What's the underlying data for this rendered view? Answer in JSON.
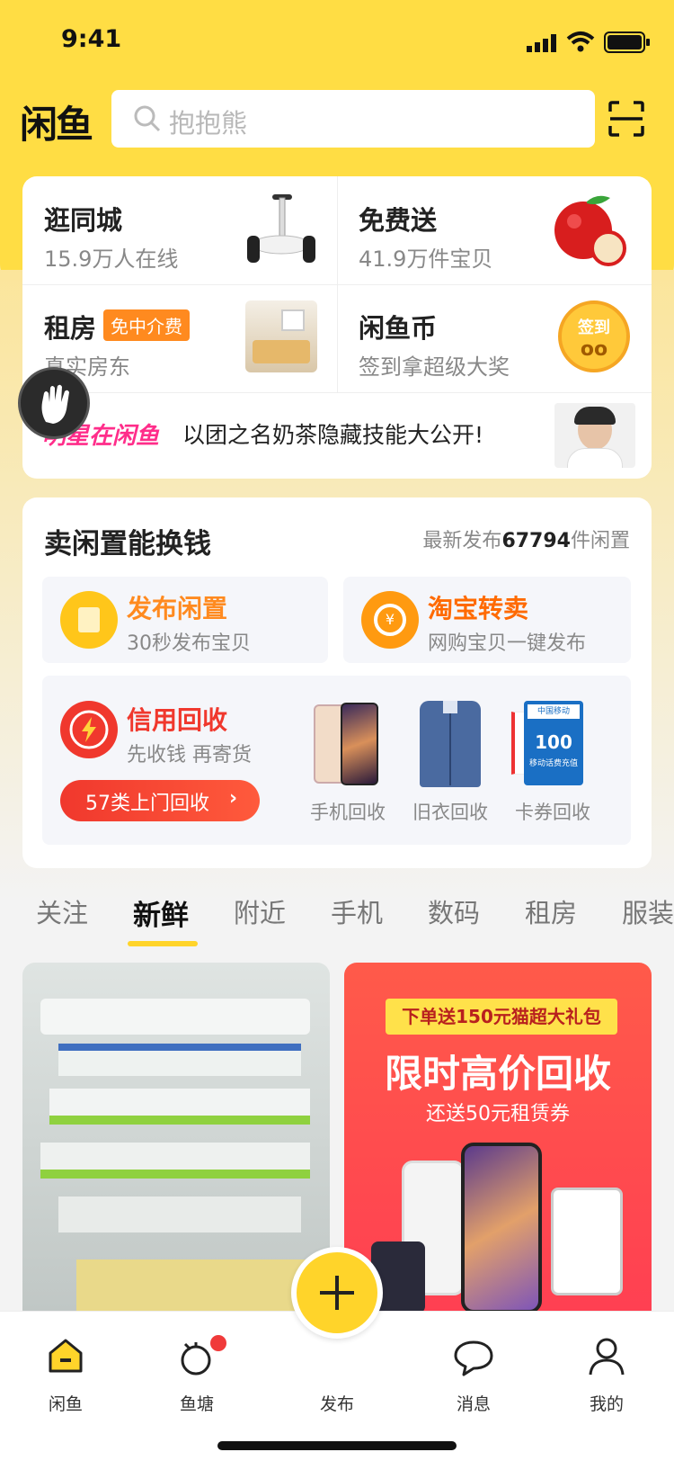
{
  "status_bar": {
    "time": "9:41"
  },
  "header": {
    "logo": "闲鱼",
    "search_placeholder": "抱抱熊"
  },
  "quick_entries": [
    {
      "title": "逛同城",
      "subtitle": "15.9万人在线"
    },
    {
      "title": "免费送",
      "subtitle": "41.9万件宝贝"
    },
    {
      "title": "租房",
      "tag": "免中介费",
      "subtitle": "真实房东"
    },
    {
      "title": "闲鱼币",
      "subtitle": "签到拿超级大奖",
      "badge": "签到"
    }
  ],
  "banner": {
    "logo": "明星在闲鱼",
    "text": "以团之名奶茶隐藏技能大公开!"
  },
  "sell": {
    "title": "卖闲置能换钱",
    "stat_prefix": "最新发布",
    "stat_count": "67794",
    "stat_suffix": "件闲置",
    "publish": {
      "title": "发布闲置",
      "subtitle": "30秒发布宝贝"
    },
    "taobao": {
      "title": "淘宝转卖",
      "subtitle": "网购宝贝一键发布"
    },
    "recycle": {
      "title": "信用回收",
      "subtitle": "先收钱 再寄货",
      "button": "57类上门回收"
    },
    "recycle_items": [
      "手机回收",
      "旧衣回收",
      "卡券回收"
    ],
    "card_texts": {
      "mobile": "中国移动",
      "amount": "100",
      "desc": "移动话费充值"
    }
  },
  "tabs": [
    "关注",
    "新鲜",
    "附近",
    "手机",
    "数码",
    "租房",
    "服装"
  ],
  "active_tab": "新鲜",
  "promo": {
    "ribbon": "下单送150元猫超大礼包",
    "headline": "限时高价回收",
    "sub": "还送50元租赁券"
  },
  "bottom_nav": [
    "闲鱼",
    "鱼塘",
    "发布",
    "消息",
    "我的"
  ],
  "colors": {
    "brand": "#ffdd44",
    "accent": "#ff8a1f",
    "red": "#f0382d"
  }
}
